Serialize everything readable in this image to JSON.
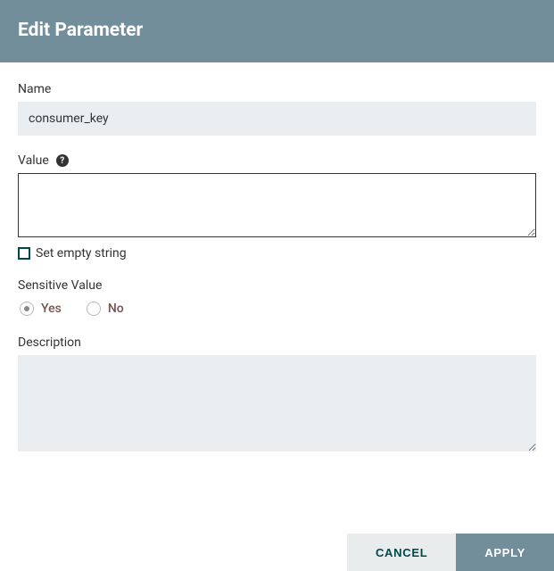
{
  "header": {
    "title": "Edit Parameter"
  },
  "fields": {
    "name": {
      "label": "Name",
      "value": "consumer_key"
    },
    "value": {
      "label": "Value",
      "value": "",
      "setEmpty": {
        "label": "Set empty string",
        "checked": false
      }
    },
    "sensitive": {
      "label": "Sensitive Value",
      "options": {
        "yes": "Yes",
        "no": "No"
      },
      "selected": "yes"
    },
    "description": {
      "label": "Description",
      "value": ""
    }
  },
  "footer": {
    "cancel": "CANCEL",
    "apply": "APPLY"
  }
}
